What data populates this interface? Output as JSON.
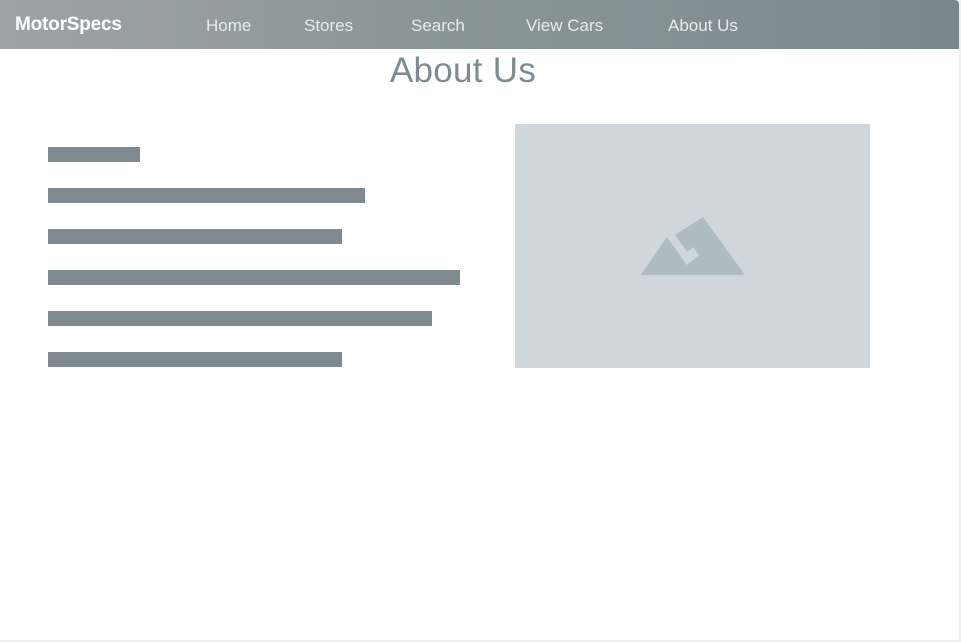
{
  "navbar": {
    "brand": "MotorSpecs",
    "links": [
      {
        "label": "Home"
      },
      {
        "label": "Stores"
      },
      {
        "label": "Search"
      },
      {
        "label": "View Cars"
      },
      {
        "label": "About Us"
      }
    ],
    "active": "About Us"
  },
  "main": {
    "title": "About Us",
    "image_icon": "mountain-image-icon",
    "placeholder_text_lines": 6
  },
  "colors": {
    "navbar_gradient_start": "#9ca3a5",
    "navbar_gradient_end": "#7a888e",
    "title": "#7e8b90",
    "text_placeholder": "#7e8a8f",
    "image_placeholder_bg": "#cfd7dc",
    "image_icon": "#aebbc0"
  }
}
